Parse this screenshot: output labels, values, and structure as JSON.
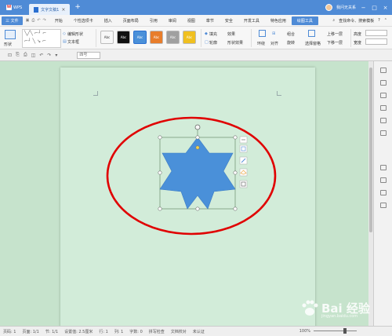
{
  "titlebar": {
    "app_label": "WPS",
    "doc_tab": "文字文稿1",
    "add_tab": "+",
    "user_name": "我问无关系",
    "window_controls": [
      "−",
      "□",
      "×"
    ]
  },
  "menubar": {
    "file": "三 文件",
    "items": [
      "开始",
      "个性选项卡",
      "插入",
      "页面布局",
      "引用",
      "审阅",
      "视图",
      "章节",
      "安全",
      "开发工具",
      "特色应用"
    ],
    "active": "绘图工具",
    "search": "查找命令、搜索模板",
    "help": "?"
  },
  "ribbon": {
    "shape_label": "形状",
    "edit_shape": "编辑形状",
    "text_box": "文本框",
    "style_boxes": [
      "Abc",
      "Abc",
      "Abc",
      "Abc",
      "Abc",
      "Abc"
    ],
    "style_colors": [
      "#ffffff",
      "#111111",
      "#4a90d9",
      "#e87d2b",
      "#a0a0a0",
      "#f0c020"
    ],
    "fill": "填充",
    "fill_tail": "轮廓",
    "shape_effect": "形状效果",
    "effect_label": "效果",
    "align": "对齐",
    "combine": "组合",
    "rotate": "旋转",
    "select_pane": "选择窗格",
    "bring_up": "上移一层",
    "send_down": "下移一层",
    "height": "高度",
    "width": "宽度",
    "wrap": "环绕"
  },
  "subbar": {
    "font_size": "四号"
  },
  "statusbar": {
    "page": "页码: 1",
    "pages": "页面: 1/1",
    "section": "节: 1/1",
    "setting": "设置值: 2.5厘米",
    "row": "行: 1",
    "col": "列: 1",
    "words": "字数: 0",
    "spell": "拼写检查",
    "proof": "文档校对",
    "cert": "未认证",
    "zoom": "100%"
  },
  "watermark": {
    "brand": "Bai 经验",
    "url": "jingyan.baidu.com"
  },
  "shape": {
    "fill_color": "#4a90d9",
    "ellipse_color": "#e00000"
  }
}
